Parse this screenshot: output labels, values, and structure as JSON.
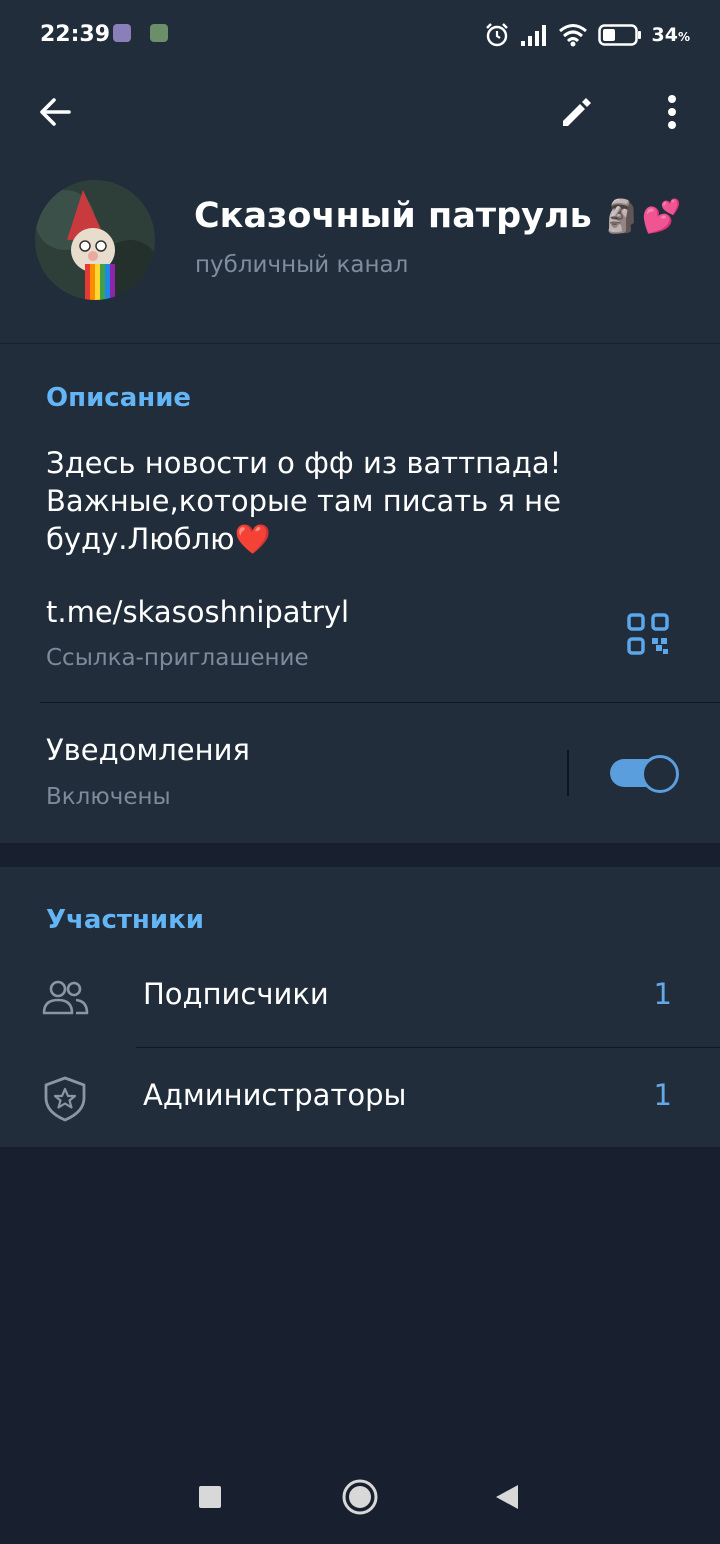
{
  "status_bar": {
    "time": "22:39",
    "battery": "34",
    "battery_unit": "%",
    "icons": [
      "app-icon-1",
      "app-icon-2",
      "alarm-icon",
      "signal-icon",
      "wifi-icon",
      "battery-icon"
    ]
  },
  "toolbar": {
    "back_icon": "arrow-left",
    "edit_icon": "pencil",
    "menu_icon": "more-vertical"
  },
  "channel": {
    "title": "Сказочный патруль",
    "title_emoji": "🗿💕",
    "subtitle": "публичный канал"
  },
  "info": {
    "section_label": "Описание",
    "description": "Здесь новости о фф из ваттпада! Важные,которые там писать я не буду.Люблю❤️",
    "link": "t.me/skasoshnipatryl",
    "link_caption": "Ссылка-приглашение",
    "notifications_title": "Уведомления",
    "notifications_state": "Включены",
    "notifications_enabled": true
  },
  "members": {
    "section_label": "Участники",
    "rows": [
      {
        "label": "Подписчики",
        "count": "1",
        "icon": "people-icon"
      },
      {
        "label": "Администраторы",
        "count": "1",
        "icon": "admin-shield-icon"
      }
    ]
  },
  "colors": {
    "accent": "#64b5f5",
    "surface": "#212d3b",
    "background": "#18202f",
    "secondary_text": "#7d8a99"
  }
}
